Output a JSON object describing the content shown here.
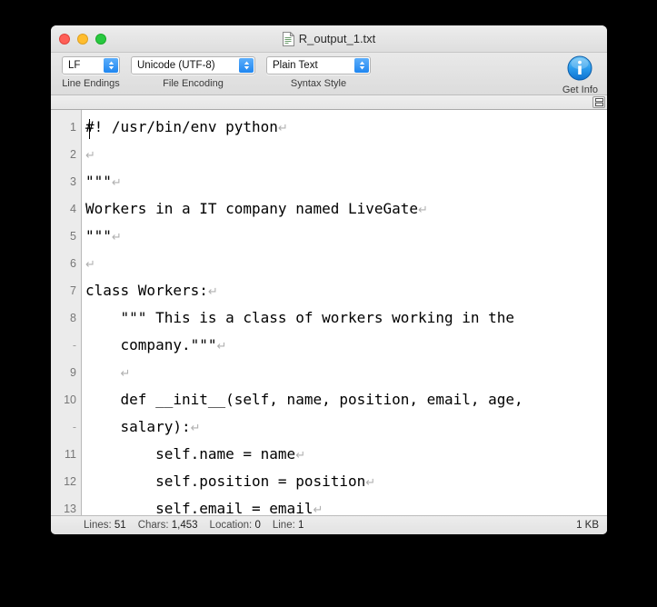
{
  "window": {
    "title": "R_output_1.txt",
    "doc_icon": "document-icon",
    "traffic_lights": [
      {
        "name": "close-button",
        "color": "#ff5f57"
      },
      {
        "name": "minimize-button",
        "color": "#ffbd2e"
      },
      {
        "name": "zoom-button",
        "color": "#28c840"
      }
    ]
  },
  "toolbar": {
    "line_endings": {
      "value": "LF",
      "caption": "Line Endings"
    },
    "file_encoding": {
      "value": "Unicode (UTF-8)",
      "caption": "File Encoding"
    },
    "syntax_style": {
      "value": "Plain Text",
      "caption": "Syntax Style"
    },
    "get_info": {
      "caption": "Get Info",
      "icon": "info-icon",
      "color": "#1f86f0"
    }
  },
  "ruler": {
    "split_button": "split-view-icon"
  },
  "editor": {
    "cursor_line": 1,
    "return_glyph": "↵",
    "lines": [
      {
        "num": "1",
        "text": "#! /usr/bin/env python",
        "eol": true,
        "caret": true
      },
      {
        "num": "2",
        "text": "",
        "eol": true,
        "caret": false
      },
      {
        "num": "3",
        "text": "\"\"\"",
        "eol": true,
        "caret": false
      },
      {
        "num": "4",
        "text": "Workers in a IT company named LiveGate",
        "eol": true,
        "caret": false
      },
      {
        "num": "5",
        "text": "\"\"\"",
        "eol": true,
        "caret": false
      },
      {
        "num": "6",
        "text": "",
        "eol": true,
        "caret": false
      },
      {
        "num": "7",
        "text": "class Workers:",
        "eol": true,
        "caret": false
      },
      {
        "num": "8",
        "text": "    \"\"\" This is a class of workers working in the",
        "eol": false,
        "caret": false
      },
      {
        "num": "-",
        "text": "    company.\"\"\"",
        "eol": true,
        "caret": false,
        "continuation": true
      },
      {
        "num": "9",
        "text": "    ",
        "eol": true,
        "caret": false
      },
      {
        "num": "10",
        "text": "    def __init__(self, name, position, email, age,",
        "eol": false,
        "caret": false
      },
      {
        "num": "-",
        "text": "    salary):",
        "eol": true,
        "caret": false,
        "continuation": true
      },
      {
        "num": "11",
        "text": "        self.name = name",
        "eol": true,
        "caret": false
      },
      {
        "num": "12",
        "text": "        self.position = position",
        "eol": true,
        "caret": false
      },
      {
        "num": "13",
        "text": "        self.email = email",
        "eol": true,
        "caret": false
      }
    ]
  },
  "statusbar": {
    "fields": [
      {
        "label": "Lines:",
        "value": "51"
      },
      {
        "label": "Chars:",
        "value": "1,453"
      },
      {
        "label": "Location:",
        "value": "0"
      },
      {
        "label": "Line:",
        "value": "1"
      }
    ],
    "file_size": "1 KB"
  }
}
